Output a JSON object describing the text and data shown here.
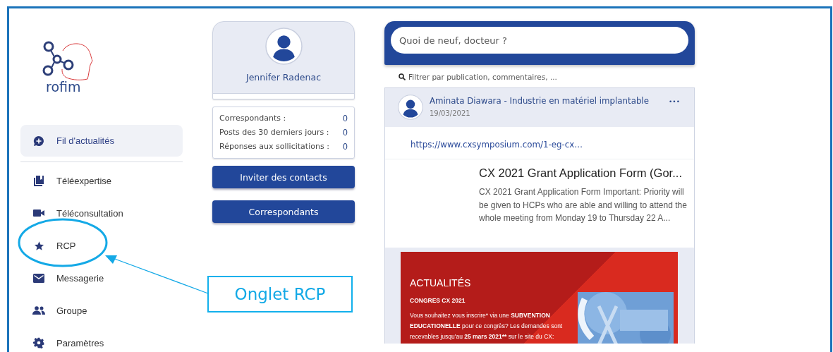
{
  "logo": {
    "text": "rofim"
  },
  "sidebar": {
    "items": [
      {
        "label": "Fil d'actualités",
        "kind": "news",
        "selected": true
      },
      {
        "label": "Téléexpertise",
        "kind": "expertise",
        "selected": false
      },
      {
        "label": "Téléconsultation",
        "kind": "video",
        "selected": false
      },
      {
        "label": "RCP",
        "kind": "star",
        "selected": false
      },
      {
        "label": "Messagerie",
        "kind": "mail",
        "selected": false
      },
      {
        "label": "Groupe",
        "kind": "group",
        "selected": false
      },
      {
        "label": "Paramètres",
        "kind": "gear",
        "selected": false
      }
    ]
  },
  "profile": {
    "name": "Jennifer Radenac",
    "stats": [
      {
        "label": "Correspondants :",
        "value": "0"
      },
      {
        "label": "Posts des 30 derniers jours :",
        "value": "0"
      },
      {
        "label": "Réponses aux sollicitations :",
        "value": "0"
      }
    ],
    "buttons": [
      "Inviter des contacts",
      "Correspondants"
    ]
  },
  "feed": {
    "compose": {
      "placeholder": "Quoi de neuf, docteur ?"
    },
    "filter": {
      "placeholder": "Filtrer par publication, commentaires, ..."
    },
    "post": {
      "author": "Aminata Diawara - Industrie en matériel implantable",
      "date": "19/03/2021",
      "more": "•••",
      "link": "https://www.cxsymposium.com/1-eg-cx…",
      "preview_title": "CX 2021 Grant Application Form (Gor...",
      "preview_text": "CX 2021 Grant Application Form Important: Priority will be given to HCPs who are able and willing to attend the whole meeting from Monday 19 to Thursday 22 A...",
      "banner": {
        "heading": "ACTUALITÉS",
        "subheading": "CONGRES CX 2021",
        "paragraph": [
          {
            "text": "Vous souhaitez vous inscrire* via une ",
            "bold": false
          },
          {
            "text": "SUBVENTION EDUCATIONELLE",
            "bold": true
          },
          {
            "text": " pour ce congrès? Les demandes sont recevables jusqu'au ",
            "bold": false
          },
          {
            "text": "25 mars 2021**",
            "bold": true
          },
          {
            "text": " sur le site du CX:",
            "bold": false
          }
        ]
      }
    }
  },
  "annotation": {
    "label": "Onglet RCP"
  }
}
